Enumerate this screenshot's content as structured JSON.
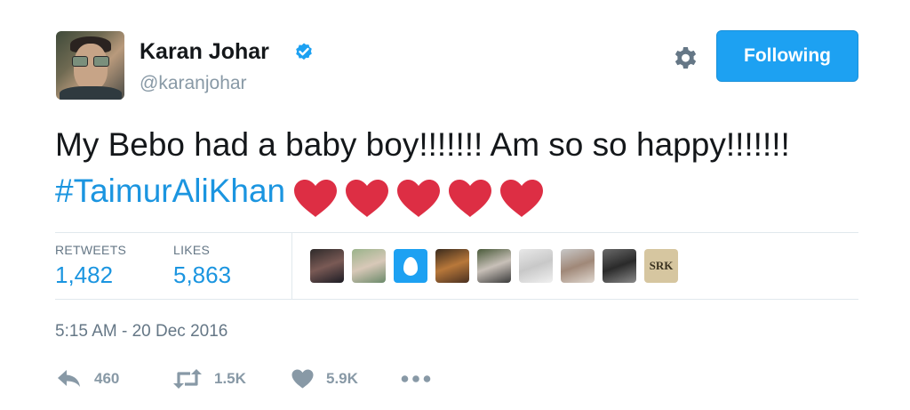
{
  "tweet": {
    "author": {
      "name": "Karan Johar",
      "handle": "@karanjohar",
      "verified_icon": "verified-badge-icon",
      "avatar": "profile-photo"
    },
    "follow_button": {
      "label": "Following"
    },
    "settings_icon": "gear-icon",
    "text": "My Bebo had a baby boy!!!!!!! Am so so happy!!!!!!! ",
    "hashtag": "#TaimurAliKhan",
    "emoji": [
      "red-heart",
      "red-heart",
      "red-heart",
      "red-heart",
      "red-heart"
    ],
    "stats": {
      "retweets_label": "RETWEETS",
      "retweets_value": "1,482",
      "likes_label": "LIKES",
      "likes_value": "5,863"
    },
    "liker_avatars": [
      "photo",
      "photo",
      "egg",
      "photo",
      "photo",
      "photo",
      "photo",
      "photo",
      "SRK"
    ],
    "timestamp": "5:15 AM - 20 Dec 2016",
    "actions": {
      "reply_count": "460",
      "retweet_count": "1.5K",
      "like_count": "5.9K"
    }
  },
  "colors": {
    "accent": "#1da1f2",
    "link": "#1b95e0",
    "heart": "#dd2e44",
    "muted": "#8899a6"
  }
}
